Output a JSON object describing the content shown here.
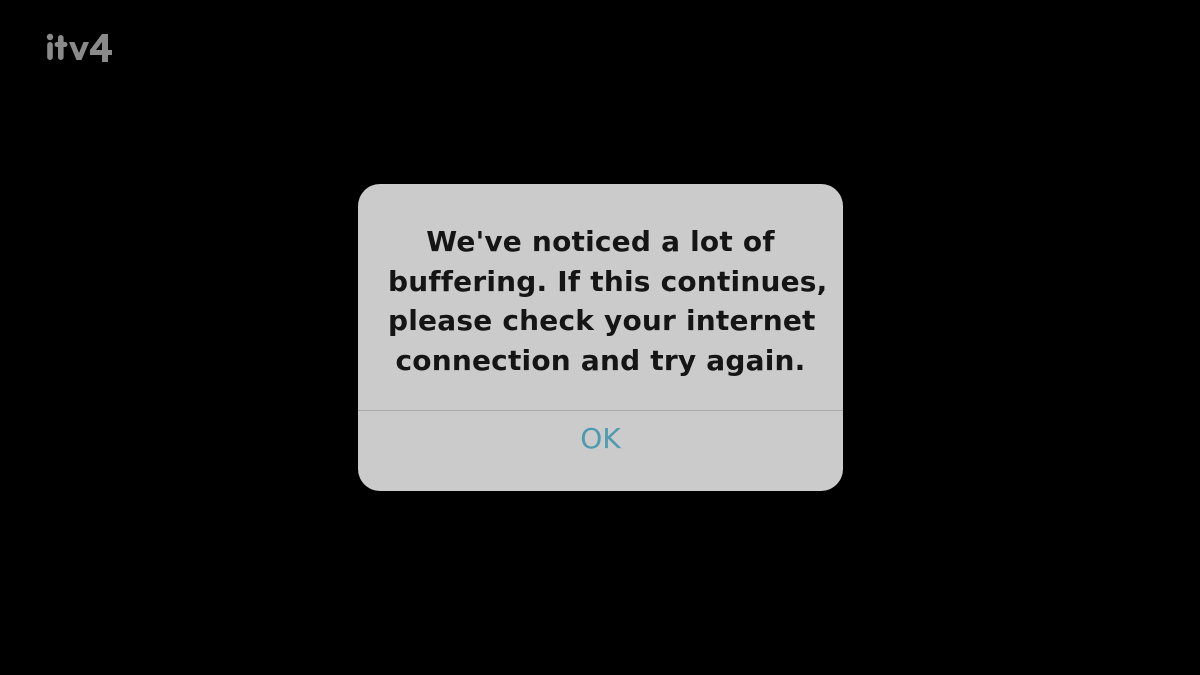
{
  "channel": {
    "logo_text": "itv4",
    "logo_color": "#8a8a8a"
  },
  "alert": {
    "message_lines": [
      "We've noticed a lot of",
      "buffering. If this continues,",
      "please check your internet",
      "connection and try again."
    ],
    "ok_label": "OK",
    "background_color": "#cbcbcb",
    "button_color": "#4e9bb0"
  }
}
